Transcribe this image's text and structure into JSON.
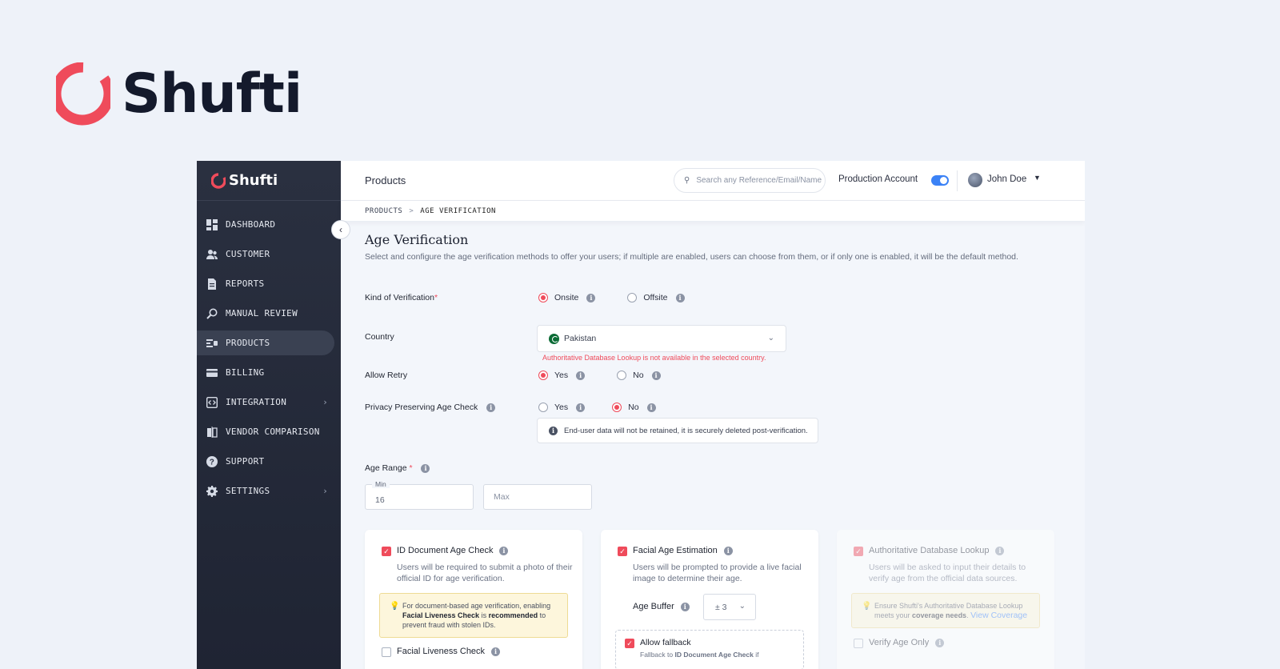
{
  "brand": {
    "name": "Shufti",
    "accent": "#ef4b5b",
    "sidebar_bg": "#232837"
  },
  "sidebar": {
    "items": [
      {
        "label": "DASHBOARD",
        "icon": "dashboard-icon"
      },
      {
        "label": "CUSTOMER",
        "icon": "users-icon"
      },
      {
        "label": "REPORTS",
        "icon": "report-icon"
      },
      {
        "label": "MANUAL REVIEW",
        "icon": "magnifier-icon"
      },
      {
        "label": "PRODUCTS",
        "icon": "products-icon",
        "active": true
      },
      {
        "label": "BILLING",
        "icon": "billing-icon"
      },
      {
        "label": "INTEGRATION",
        "icon": "code-icon",
        "has_submenu": true
      },
      {
        "label": "VENDOR COMPARISON",
        "icon": "compare-icon"
      },
      {
        "label": "SUPPORT",
        "icon": "help-icon"
      },
      {
        "label": "SETTINGS",
        "icon": "gear-icon",
        "has_submenu": true
      }
    ]
  },
  "topbar": {
    "title": "Products",
    "search_placeholder": "Search any Reference/Email/Name",
    "production_label": "Production Account",
    "production_enabled": true,
    "user_name": "John Doe"
  },
  "breadcrumb": {
    "parent": "PRODUCTS",
    "separator": ">",
    "current": "AGE VERIFICATION"
  },
  "page": {
    "title": "Age Verification",
    "description": "Select and configure the age verification methods to offer your users; if multiple are enabled, users can choose from them, or if only one is enabled, it will be the default method."
  },
  "form": {
    "kind": {
      "label": "Kind of Verification",
      "required_mark": "*",
      "options": [
        "Onsite",
        "Offsite"
      ],
      "selected": "Onsite"
    },
    "country": {
      "label": "Country",
      "value": "Pakistan",
      "error": "Authoritative Database Lookup is not available in the selected country."
    },
    "retry": {
      "label": "Allow Retry",
      "options": [
        "Yes",
        "No"
      ],
      "selected": "Yes"
    },
    "privacy": {
      "label": "Privacy Preserving Age Check",
      "options": [
        "Yes",
        "No"
      ],
      "selected": "No",
      "note": "End-user data will not be retained, it is securely deleted post-verification."
    },
    "age_range": {
      "label": "Age Range",
      "required_mark": "*",
      "min_label": "Min",
      "min_value": "16",
      "max_placeholder": "Max"
    }
  },
  "cards": {
    "id_doc": {
      "title": "ID Document Age Check",
      "checked": true,
      "description": "Users will be required to submit a photo of their official ID for age verification.",
      "tip_pre": "For document-based age verification, enabling ",
      "tip_bold": "Facial Liveness Check",
      "tip_mid": " is ",
      "tip_bold2": "recommended",
      "tip_post": " to prevent fraud with stolen IDs.",
      "row2": "Facial Liveness Check"
    },
    "facial": {
      "title": "Facial Age Estimation",
      "checked": true,
      "description": "Users will be prompted to provide a live facial image to determine their age.",
      "buffer_label": "Age Buffer",
      "buffer_value": "± 3",
      "fallback_label": "Allow fallback",
      "fallback_sub_pre": "Fallback to ",
      "fallback_sub_bold": "ID Document Age Check",
      "fallback_sub_post": " if"
    },
    "db": {
      "title": "Authoritative Database Lookup",
      "checked": true,
      "description": "Users will be asked to input their details to verify age from the official data sources.",
      "tip_pre": "Ensure Shufti's Authoritative Database Lookup meets your ",
      "tip_bold": "coverage needs",
      "tip_post": ". ",
      "tip_link": "View Coverage",
      "row2": "Verify Age Only"
    }
  }
}
